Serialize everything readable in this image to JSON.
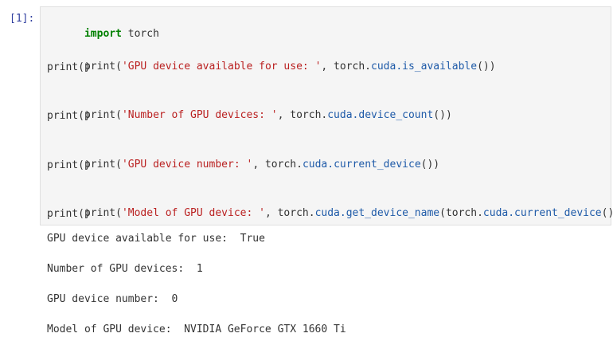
{
  "cell": {
    "prompt": "[1]:",
    "code": {
      "line1": {
        "kw": "import",
        "plain": " torch"
      },
      "line2": {
        "fn": "print(",
        "str": "'GPU device available for use: '",
        "mid": ", torch.",
        "attr": "cuda.is_available",
        "end": "())"
      },
      "line3": {
        "plain": "print()"
      },
      "line4": {
        "fn": "print(",
        "str": "'Number of GPU devices: '",
        "mid": ", torch.",
        "attr": "cuda.device_count",
        "end": "())"
      },
      "line5": {
        "plain": "print()"
      },
      "line6": {
        "fn": "print(",
        "str": "'GPU device number: '",
        "mid": ", torch.",
        "attr": "cuda.current_device",
        "end": "())"
      },
      "line7": {
        "plain": "print()"
      },
      "line8": {
        "fn": "print(",
        "str": "'Model of GPU device: '",
        "mid": ", torch.",
        "attr": "cuda.get_device_name",
        "mid2": "(torch.",
        "attr2": "cuda.current_device",
        "end": "()))"
      },
      "line9": {
        "plain": "print()"
      }
    },
    "output": {
      "line1": "GPU device available for use:  True",
      "line2": "Number of GPU devices:  1",
      "line3": "GPU device number:  0",
      "line4": "Model of GPU device:  NVIDIA GeForce GTX 1660 Ti"
    },
    "colors": {
      "prompt": "#303f9f",
      "keyword": "#008000",
      "string": "#ba2121",
      "attribute": "#1e5aa8",
      "editor_bg": "#f5f5f5"
    }
  }
}
